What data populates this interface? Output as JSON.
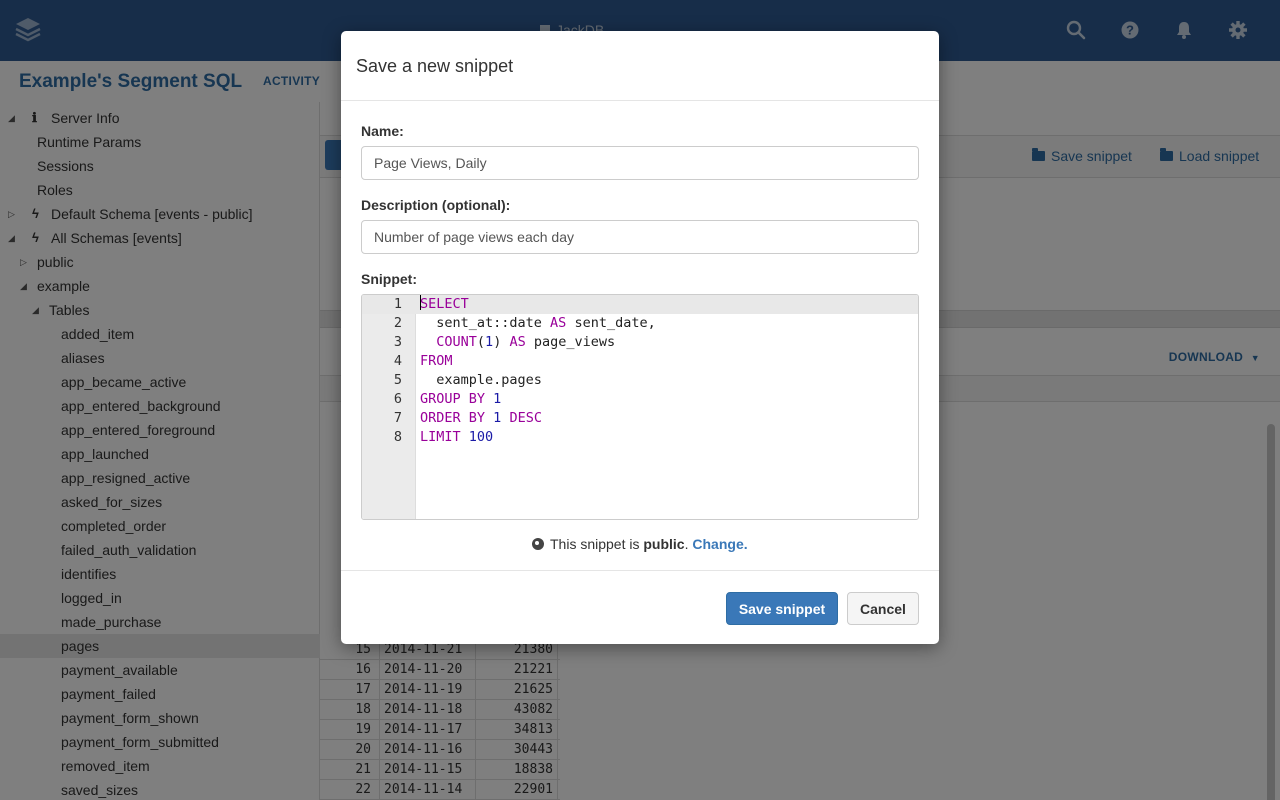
{
  "app": {
    "name": "JackDB",
    "connection_title": "Example's Segment SQL",
    "activity_label": "ACTIVITY"
  },
  "topbar_icons": [
    "search-icon",
    "help-icon",
    "bell-icon",
    "gear-icon"
  ],
  "sidebar": {
    "items": [
      {
        "label": "Server Info",
        "icon": "info-icon",
        "caret": "open",
        "indent": 0
      },
      {
        "label": "Runtime Params",
        "indent": 1
      },
      {
        "label": "Sessions",
        "indent": 1
      },
      {
        "label": "Roles",
        "indent": 1
      },
      {
        "label": "Default Schema [events - public]",
        "icon": "bolt-icon",
        "caret": "closed",
        "indent": 0
      },
      {
        "label": "All Schemas [events]",
        "icon": "bolt-icon",
        "caret": "open",
        "indent": 0
      },
      {
        "label": "public",
        "caret": "closed",
        "indent": 1
      },
      {
        "label": "example",
        "caret": "open",
        "indent": 1
      },
      {
        "label": "Tables",
        "caret": "open",
        "indent": 2
      },
      {
        "label": "added_item",
        "indent": 3
      },
      {
        "label": "aliases",
        "indent": 3
      },
      {
        "label": "app_became_active",
        "indent": 3
      },
      {
        "label": "app_entered_background",
        "indent": 3
      },
      {
        "label": "app_entered_foreground",
        "indent": 3
      },
      {
        "label": "app_launched",
        "indent": 3
      },
      {
        "label": "app_resigned_active",
        "indent": 3
      },
      {
        "label": "asked_for_sizes",
        "indent": 3
      },
      {
        "label": "completed_order",
        "indent": 3
      },
      {
        "label": "failed_auth_validation",
        "indent": 3
      },
      {
        "label": "identifies",
        "indent": 3
      },
      {
        "label": "logged_in",
        "indent": 3
      },
      {
        "label": "made_purchase",
        "indent": 3
      },
      {
        "label": "pages",
        "indent": 3,
        "selected": true
      },
      {
        "label": "payment_available",
        "indent": 3
      },
      {
        "label": "payment_failed",
        "indent": 3
      },
      {
        "label": "payment_form_shown",
        "indent": 3
      },
      {
        "label": "payment_form_submitted",
        "indent": 3
      },
      {
        "label": "removed_item",
        "indent": 3
      },
      {
        "label": "saved_sizes",
        "indent": 3
      }
    ]
  },
  "toolbar": {
    "save_snippet": "Save snippet",
    "load_snippet": "Load snippet"
  },
  "results": {
    "download_label": "DOWNLOAD",
    "rows": [
      {
        "n": "15",
        "date": "2014-11-21",
        "value": "21380"
      },
      {
        "n": "16",
        "date": "2014-11-20",
        "value": "21221"
      },
      {
        "n": "17",
        "date": "2014-11-19",
        "value": "21625"
      },
      {
        "n": "18",
        "date": "2014-11-18",
        "value": "43082"
      },
      {
        "n": "19",
        "date": "2014-11-17",
        "value": "34813"
      },
      {
        "n": "20",
        "date": "2014-11-16",
        "value": "30443"
      },
      {
        "n": "21",
        "date": "2014-11-15",
        "value": "18838"
      },
      {
        "n": "22",
        "date": "2014-11-14",
        "value": "22901"
      }
    ]
  },
  "modal": {
    "title": "Save a new snippet",
    "name_label": "Name:",
    "name_value": "Page Views, Daily",
    "description_label": "Description (optional):",
    "description_value": "Number of page views each day",
    "snippet_label": "Snippet:",
    "code_lines": [
      [
        {
          "t": "SELECT",
          "c": "kw"
        }
      ],
      [
        {
          "t": "  sent_at::date "
        },
        {
          "t": "AS",
          "c": "kw"
        },
        {
          "t": " sent_date,"
        }
      ],
      [
        {
          "t": "  "
        },
        {
          "t": "COUNT",
          "c": "kw"
        },
        {
          "t": "("
        },
        {
          "t": "1",
          "c": "num"
        },
        {
          "t": ") "
        },
        {
          "t": "AS",
          "c": "kw"
        },
        {
          "t": " page_views"
        }
      ],
      [
        {
          "t": "FROM",
          "c": "kw"
        }
      ],
      [
        {
          "t": "  example.pages"
        }
      ],
      [
        {
          "t": "GROUP BY",
          "c": "kw"
        },
        {
          "t": " "
        },
        {
          "t": "1",
          "c": "num"
        }
      ],
      [
        {
          "t": "ORDER BY",
          "c": "kw"
        },
        {
          "t": " "
        },
        {
          "t": "1",
          "c": "num"
        },
        {
          "t": " "
        },
        {
          "t": "DESC",
          "c": "kw"
        }
      ],
      [
        {
          "t": "LIMIT",
          "c": "kw"
        },
        {
          "t": " "
        },
        {
          "t": "100",
          "c": "num"
        }
      ]
    ],
    "visibility_prefix": "This snippet is ",
    "visibility_value": "public",
    "visibility_suffix": ". ",
    "change_link": "Change.",
    "save_button": "Save snippet",
    "cancel_button": "Cancel"
  }
}
